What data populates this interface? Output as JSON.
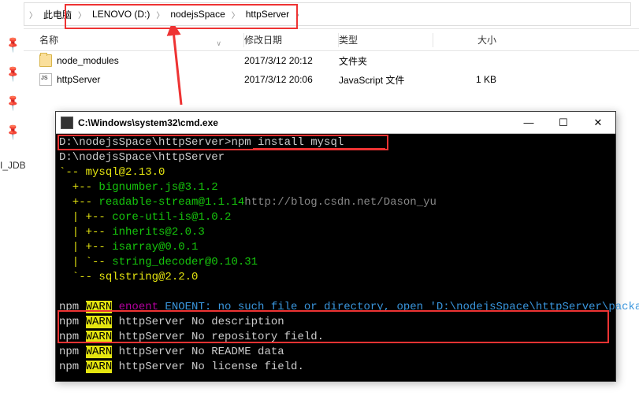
{
  "breadcrumb": {
    "root": "此电脑",
    "seg1": "LENOVO (D:)",
    "seg2": "nodejsSpace",
    "seg3": "httpServer"
  },
  "columns": {
    "name": "名称",
    "date": "修改日期",
    "type": "类型",
    "size": "大小"
  },
  "files": [
    {
      "icon": "folder",
      "name": "node_modules",
      "date": "2017/3/12 20:12",
      "type": "文件夹",
      "size": ""
    },
    {
      "icon": "js",
      "name": "httpServer",
      "date": "2017/3/12 20:06",
      "type": "JavaScript 文件",
      "size": "1 KB"
    }
  ],
  "sidebar_label": "I_JDB",
  "terminal": {
    "title": "C:\\Windows\\system32\\cmd.exe",
    "buttons": {
      "min": "—",
      "max": "☐",
      "close": "✕"
    },
    "prompt1": "D:\\nodejsSpace\\httpServer>",
    "cmd": "npm install mysql",
    "echo": "D:\\nodejsSpace\\httpServer",
    "watermark": "http://blog.csdn.net/Dason_yu",
    "tree": [
      {
        "pre": "`-- ",
        "pkg": "mysql@2.13.0",
        "color": "y"
      },
      {
        "pre": "  +-- ",
        "pkg": "bignumber.js@3.1.2",
        "color": "g"
      },
      {
        "pre": "  +-- ",
        "pkg": "readable-stream@1.1.14",
        "color": "g",
        "tail": "http://blog.csdn.net/Dason_yu"
      },
      {
        "pre": "  | +-- ",
        "pkg": "core-util-is@1.0.2",
        "color": "g"
      },
      {
        "pre": "  | +-- ",
        "pkg": "inherits@2.0.3",
        "color": "g"
      },
      {
        "pre": "  | +-- ",
        "pkg": "isarray@0.0.1",
        "color": "g"
      },
      {
        "pre": "  | `-- ",
        "pkg": "string_decoder@0.10.31",
        "color": "g"
      },
      {
        "pre": "  `-- ",
        "pkg": "sqlstring@2.2.0",
        "color": "y"
      }
    ],
    "warn_enoent": {
      "npm": "npm ",
      "warn": "WARN",
      "enoent": " enoent",
      "msg": " ENOENT: no such file or directory, open 'D:\\nodejsSpace\\httpServer\\package.json'"
    },
    "warns": [
      "httpServer No description",
      "httpServer No repository field.",
      "httpServer No README data",
      "httpServer No license field."
    ]
  }
}
